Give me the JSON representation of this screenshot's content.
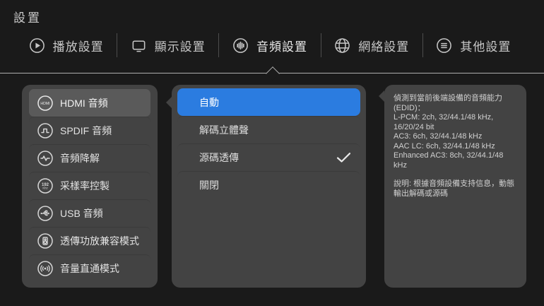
{
  "app": {
    "title": "設置"
  },
  "tabs": {
    "items": [
      {
        "label": "播放設置",
        "icon": "play-icon",
        "active": false
      },
      {
        "label": "顯示設置",
        "icon": "display-icon",
        "active": false
      },
      {
        "label": "音頻設置",
        "icon": "equalizer-icon",
        "active": true
      },
      {
        "label": "網絡設置",
        "icon": "globe-icon",
        "active": false
      },
      {
        "label": "其他設置",
        "icon": "menu-circle-icon",
        "active": false
      }
    ]
  },
  "sidebar": {
    "items": [
      {
        "label": "HDMI 音頻",
        "icon": "hdmi-icon",
        "icon_text": "HDMI",
        "selected": true
      },
      {
        "label": "SPDIF 音頻",
        "icon": "spdif-icon",
        "selected": false
      },
      {
        "label": "音頻降解",
        "icon": "waveform-icon",
        "selected": false
      },
      {
        "label": "采樣率控製",
        "icon": "samplerate-icon",
        "icon_text_top": "192",
        "icon_text_bottom": "Khz",
        "selected": false
      },
      {
        "label": "USB 音頻",
        "icon": "usb-icon",
        "selected": false
      },
      {
        "label": "透傳功放兼容模式",
        "icon": "amp-speaker-icon",
        "selected": false
      },
      {
        "label": "音量直通模式",
        "icon": "volume-passthrough-icon",
        "selected": false
      }
    ]
  },
  "options": {
    "items": [
      {
        "label": "自動",
        "focused": true,
        "checked": false
      },
      {
        "label": "解碼立體聲",
        "focused": false,
        "checked": false
      },
      {
        "label": "源碼透傳",
        "focused": false,
        "checked": true
      },
      {
        "label": "關閉",
        "focused": false,
        "checked": false
      }
    ]
  },
  "info_panel": {
    "edid_text": "偵測到當前後端設備的音頻能力\n(EDID)：\nL-PCM: 2ch, 32/44.1/48 kHz,\n16/20/24 bit\nAC3: 6ch, 32/44.1/48 kHz\nAAC LC: 6ch, 32/44.1/48 kHz\nEnhanced AC3: 8ch, 32/44.1/48\nkHz",
    "note_text": "說明: 根據音頻設備支持信息，動態\n輸出解碼或源碼"
  },
  "colors": {
    "accent_blue": "#2b7ce0",
    "panel_gray": "#434343",
    "selected_item_gray": "#5a5a5a",
    "background": "#1a1a1a",
    "divider": "#aeaeae"
  }
}
